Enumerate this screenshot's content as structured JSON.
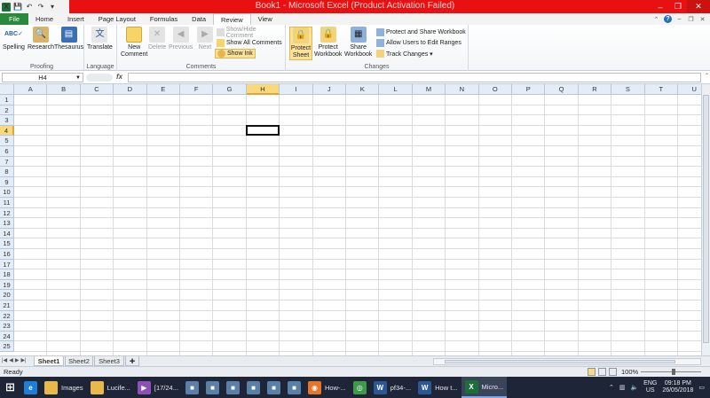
{
  "window": {
    "title": "Book1 - Microsoft Excel (Product Activation Failed)",
    "minimize_icon": "minimize-icon",
    "restore_icon": "restore-icon",
    "close_icon": "close-icon"
  },
  "quick_access": {
    "app_icon": "X",
    "save_icon": "💾",
    "undo_icon": "↶",
    "redo_icon": "↷",
    "customize_icon": "▾"
  },
  "tabs": [
    "File",
    "Home",
    "Insert",
    "Page Layout",
    "Formulas",
    "Data",
    "Review",
    "View"
  ],
  "active_tab": "Review",
  "ribbon": {
    "proofing": {
      "label": "Proofing",
      "spelling": "Spelling",
      "research": "Research",
      "thesaurus": "Thesaurus"
    },
    "language": {
      "label": "Language",
      "translate": "Translate"
    },
    "comments": {
      "label": "Comments",
      "new_comment_line1": "New",
      "new_comment_line2": "Comment",
      "delete": "Delete",
      "previous": "Previous",
      "next": "Next",
      "show_hide_comment": "Show/Hide Comment",
      "show_all_comments": "Show All Comments",
      "show_ink": "Show Ink"
    },
    "changes": {
      "label": "Changes",
      "protect_sheet_line1": "Protect",
      "protect_sheet_line2": "Sheet",
      "protect_workbook_line1": "Protect",
      "protect_workbook_line2": "Workbook",
      "share_workbook_line1": "Share",
      "share_workbook_line2": "Workbook",
      "protect_and_share": "Protect and Share Workbook",
      "allow_users": "Allow Users to Edit Ranges",
      "track_changes": "Track Changes ▾"
    }
  },
  "formula_bar": {
    "name_box": "H4",
    "fx_label": "fx",
    "formula": ""
  },
  "grid": {
    "columns": [
      "A",
      "B",
      "C",
      "D",
      "E",
      "F",
      "G",
      "H",
      "I",
      "J",
      "K",
      "L",
      "M",
      "N",
      "O",
      "P",
      "Q",
      "R",
      "S",
      "T",
      "U"
    ],
    "rows": [
      "1",
      "2",
      "3",
      "4",
      "5",
      "6",
      "7",
      "8",
      "9",
      "10",
      "11",
      "12",
      "13",
      "14",
      "15",
      "16",
      "17",
      "18",
      "19",
      "20",
      "21",
      "22",
      "23",
      "24",
      "25"
    ],
    "selected_column": "H",
    "selected_row": "4"
  },
  "sheets": [
    "Sheet1",
    "Sheet2",
    "Sheet3"
  ],
  "active_sheet": "Sheet1",
  "status": {
    "text": "Ready",
    "zoom": "100%"
  },
  "taskbar": {
    "items": [
      {
        "label": "",
        "icon": "windows-start-icon"
      },
      {
        "label": "",
        "icon": "internet-explorer-icon"
      },
      {
        "label": "Images",
        "icon": "folder-icon"
      },
      {
        "label": "Lucife...",
        "icon": "folder-icon"
      },
      {
        "label": "[17/24...",
        "icon": "media-player-icon"
      },
      {
        "label": "",
        "icon": "app-icon"
      },
      {
        "label": "",
        "icon": "app-icon"
      },
      {
        "label": "",
        "icon": "app-icon"
      },
      {
        "label": "",
        "icon": "app-icon"
      },
      {
        "label": "",
        "icon": "app-icon"
      },
      {
        "label": "",
        "icon": "app-icon"
      },
      {
        "label": "How-...",
        "icon": "firefox-icon"
      },
      {
        "label": "",
        "icon": "chrome-icon"
      },
      {
        "label": "pf34-...",
        "icon": "word-icon"
      },
      {
        "label": "How t...",
        "icon": "word-icon"
      },
      {
        "label": "Micro...",
        "icon": "excel-icon"
      }
    ],
    "tray": {
      "language_line1": "ENG",
      "language_line2": "US",
      "time": "09:18 PM",
      "date": "26/05/2018"
    }
  },
  "colors": {
    "title_bar": "#e81010",
    "file_tab": "#2a8a3c",
    "selected_header": "#f9d97b",
    "taskbar": "#1d2536"
  }
}
